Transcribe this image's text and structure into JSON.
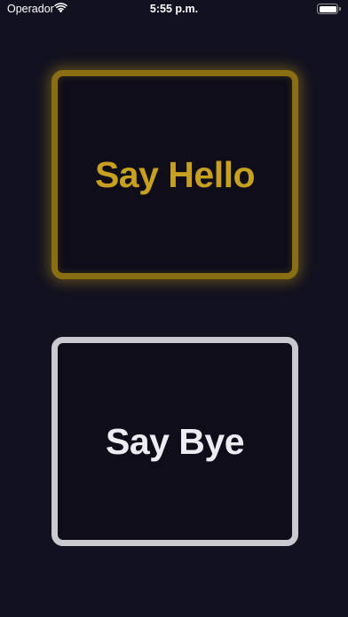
{
  "status_bar": {
    "carrier": "Operador",
    "time": "5:55 p.m.",
    "wifi_icon": "wifi-icon",
    "battery_icon": "battery-icon",
    "battery_level": 1.0
  },
  "buttons": {
    "hello": {
      "label": "Say Hello",
      "color": "#c8a01f",
      "border_color": "#8a6f12"
    },
    "bye": {
      "label": "Say Bye",
      "color": "#ececf2",
      "border_color": "#c9c9cf"
    }
  },
  "colors": {
    "background": "#12111f"
  }
}
